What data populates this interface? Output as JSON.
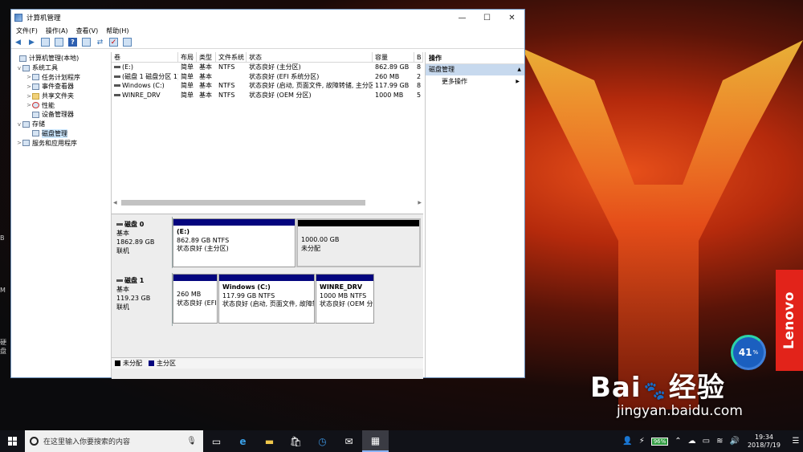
{
  "window": {
    "title": "计算机管理",
    "controls": [
      "—",
      "☐",
      "✕"
    ]
  },
  "menu": [
    "文件(F)",
    "操作(A)",
    "查看(V)",
    "帮助(H)"
  ],
  "tree": [
    {
      "label": "计算机管理(本地)",
      "indent": 0,
      "exp": "",
      "sel": false
    },
    {
      "label": "系统工具",
      "indent": 1,
      "exp": "v",
      "sel": false
    },
    {
      "label": "任务计划程序",
      "indent": 2,
      "exp": ">",
      "sel": false
    },
    {
      "label": "事件查看器",
      "indent": 2,
      "exp": ">",
      "sel": false
    },
    {
      "label": "共享文件夹",
      "indent": 2,
      "exp": ">",
      "sel": false
    },
    {
      "label": "性能",
      "indent": 2,
      "exp": ">",
      "sel": false
    },
    {
      "label": "设备管理器",
      "indent": 2,
      "exp": "",
      "sel": false
    },
    {
      "label": "存储",
      "indent": 1,
      "exp": "v",
      "sel": false
    },
    {
      "label": "磁盘管理",
      "indent": 2,
      "exp": "",
      "sel": true
    },
    {
      "label": "服务和应用程序",
      "indent": 1,
      "exp": ">",
      "sel": false
    }
  ],
  "volume_table": {
    "headers": [
      "卷",
      "布局",
      "类型",
      "文件系统",
      "状态",
      "容量",
      "B"
    ],
    "rows": [
      [
        "(E:)",
        "简单",
        "基本",
        "NTFS",
        "状态良好 (主分区)",
        "862.89 GB",
        "8"
      ],
      [
        "(磁盘 1 磁盘分区 1)",
        "简单",
        "基本",
        "",
        "状态良好 (EFI 系统分区)",
        "260 MB",
        "2"
      ],
      [
        "Windows (C:)",
        "简单",
        "基本",
        "NTFS",
        "状态良好 (启动, 页面文件, 故障转储, 主分区)",
        "117.99 GB",
        "8"
      ],
      [
        "WINRE_DRV",
        "简单",
        "基本",
        "NTFS",
        "状态良好 (OEM 分区)",
        "1000 MB",
        "5"
      ]
    ]
  },
  "disks": [
    {
      "name": "磁盘 0",
      "type": "基本",
      "size": "1862.89 GB",
      "status": "联机",
      "parts": [
        {
          "name": "(E:)",
          "line1": "862.89 GB NTFS",
          "line2": "状态良好 (主分区)",
          "unalloc": false
        },
        {
          "name": "",
          "line1": "1000.00 GB",
          "line2": "未分配",
          "unalloc": true
        }
      ]
    },
    {
      "name": "磁盘 1",
      "type": "基本",
      "size": "119.23 GB",
      "status": "联机",
      "parts": [
        {
          "name": "",
          "line1": "260 MB",
          "line2": "状态良好 (EFI",
          "unalloc": false
        },
        {
          "name": "Windows  (C:)",
          "line1": "117.99 GB NTFS",
          "line2": "状态良好 (启动, 页面文件, 故障转",
          "unalloc": false
        },
        {
          "name": "WINRE_DRV",
          "line1": "1000 MB NTFS",
          "line2": "状态良好 (OEM 分",
          "unalloc": false
        }
      ]
    }
  ],
  "legend": [
    {
      "label": "未分配",
      "color": "#000000"
    },
    {
      "label": "主分区",
      "color": "#04057e"
    }
  ],
  "actions": {
    "header": "操作",
    "section": "磁盘管理",
    "item": "更多操作"
  },
  "taskbar": {
    "search_placeholder": "在这里输入你要搜索的内容",
    "battery": "96%",
    "time": "19:34",
    "date": "2018/7/19"
  },
  "desktop": {
    "gauge_value": "41",
    "gauge_unit": "%",
    "brand": "Lenovo",
    "watermark": "Bai",
    "watermark_cn": "经验",
    "watermark_url": "jingyan.baidu.com",
    "left_labels": [
      "B",
      "M",
      "硬盘"
    ]
  },
  "colors": {
    "primary_partition": "#04057e",
    "unallocated": "#000000",
    "selection": "#cce8ff",
    "action_section": "#c7d9ee"
  }
}
